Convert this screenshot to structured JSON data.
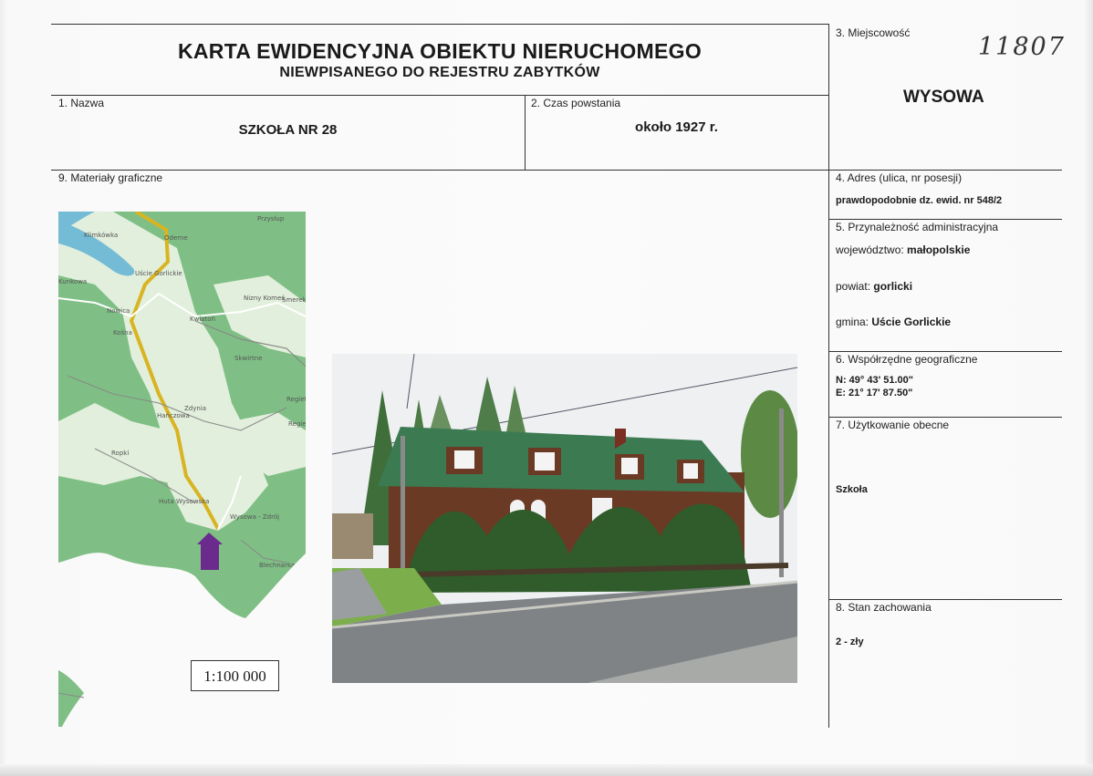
{
  "header": {
    "title_main": "KARTA EWIDENCYJNA OBIEKTU NIERUCHOMEGO",
    "title_sub": "NIEWPISANEGO DO REJESTRU ZABYTKÓW",
    "card_number": "11807"
  },
  "fields": {
    "miejscowosc": {
      "label": "3. Miejscowość",
      "value": "WYSOWA"
    },
    "nazwa": {
      "label": "1. Nazwa",
      "value": "SZKOŁA NR 28"
    },
    "czas_powstania": {
      "label": "2. Czas powstania",
      "value": "około 1927 r."
    },
    "materialy": {
      "label": "9. Materiały graficzne"
    },
    "adres": {
      "label": "4. Adres (ulica, nr posesji)",
      "value": "prawdopodobnie dz. ewid. nr 548/2"
    },
    "przynaleznosc": {
      "label": "5. Przynależność administracyjna",
      "wojewodztwo_label": "województwo:",
      "wojewodztwo": "małopolskie",
      "powiat_label": "powiat:",
      "powiat": "gorlicki",
      "gmina_label": "gmina:",
      "gmina": "Uście Gorlickie"
    },
    "wspolrzedne": {
      "label": "6. Współrzędne geograficzne",
      "n": "N: 49° 43' 51.00\"",
      "e": "E: 21° 17' 87.50\""
    },
    "uzytkowanie": {
      "label": "7. Użytkowanie obecne",
      "value": "Szkoła"
    },
    "stan": {
      "label": "8. Stan zachowania",
      "value": "2 - zły"
    }
  },
  "map": {
    "scale": "1:100 000",
    "places": [
      "Przysłup",
      "Klimkówka",
      "Oderne",
      "Uście Gorlickie",
      "Kunkowa",
      "Nowica",
      "Kwiatoń",
      "Nizny Komeś",
      "Smerekowiec",
      "Kośna",
      "Skwirtne",
      "Regietów",
      "Hańczowa",
      "Zdynia",
      "Ropki",
      "Huta Wysowska",
      "Wysowa - Zdrój",
      "Blechnarka",
      "Regietów Wyżny"
    ],
    "colors": {
      "forest": "#7fbf85",
      "open": "#e2efdc",
      "water": "#74bcd6",
      "road": "#d9b422",
      "marker": "#6b2b8c"
    }
  },
  "photo": {
    "subject": "school building"
  }
}
